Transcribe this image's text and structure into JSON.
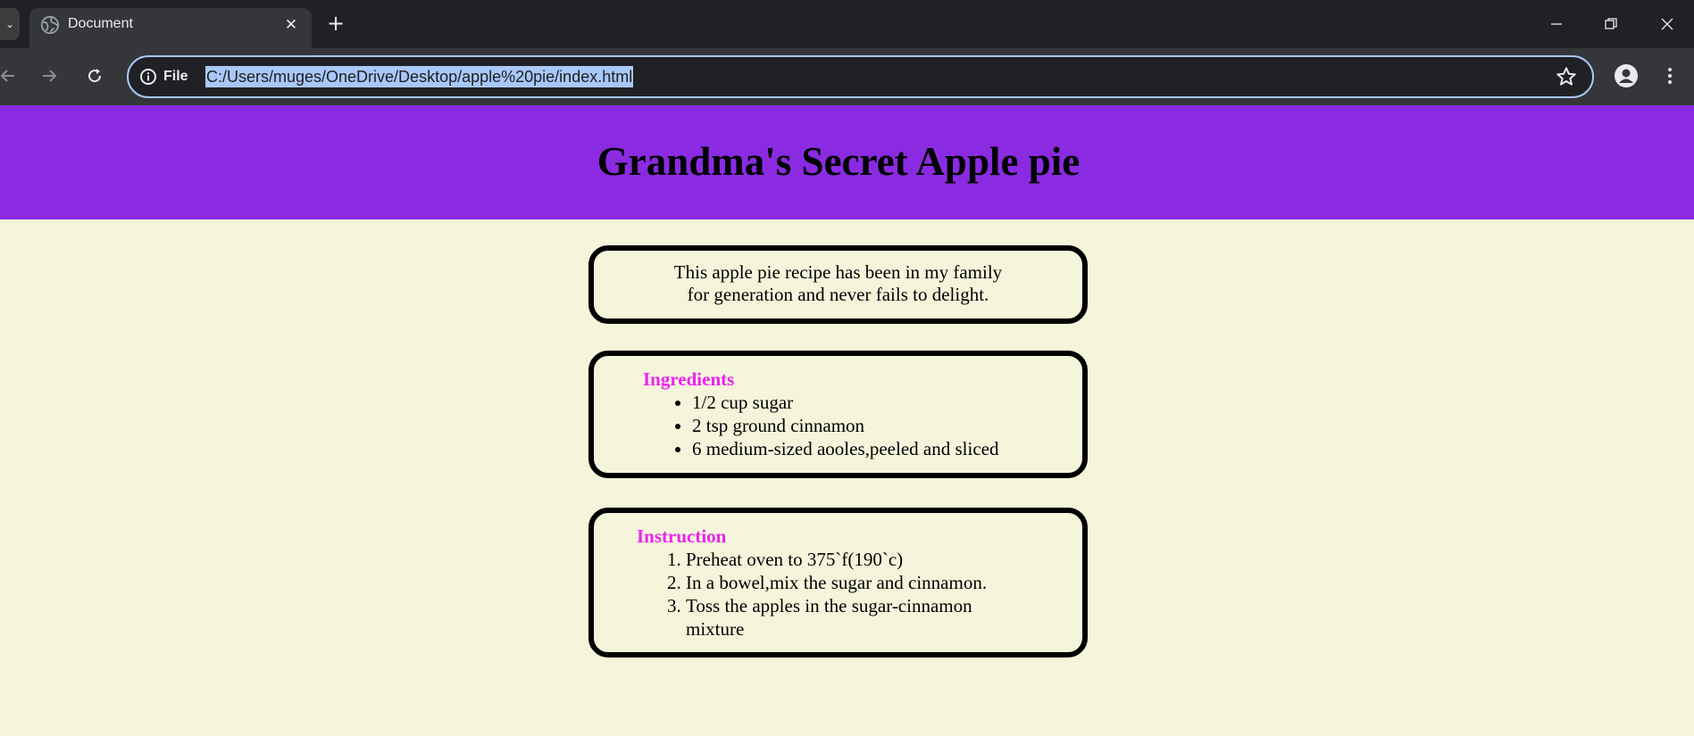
{
  "browser": {
    "tab_title": "Document",
    "site_info_label": "File",
    "url": "C:/Users/muges/OneDrive/Desktop/apple%20pie/index.html"
  },
  "page": {
    "title": "Grandma's Secret Apple pie",
    "intro_line1": "This apple pie recipe has been in my family",
    "intro_line2": "for generation and never fails to delight.",
    "ingredients_heading": "Ingredients",
    "ingredients": [
      "1/2 cup sugar",
      "2 tsp ground cinnamon",
      "6 medium-sized aooles,peeled and sliced"
    ],
    "instructions_heading": "Instruction",
    "instructions": [
      "Preheat oven to 375`f(190`c)",
      "In a bowel,mix the sugar and cinnamon.",
      "Toss the apples in the sugar-cinnamon mixture"
    ]
  },
  "colors": {
    "header_bg": "#8a2be2",
    "page_bg": "#f5f5dc",
    "heading_accent": "#ee22ee"
  }
}
